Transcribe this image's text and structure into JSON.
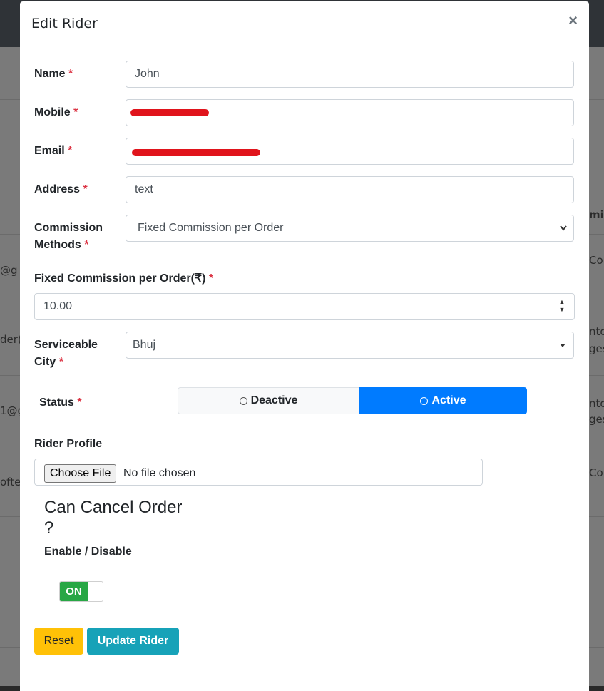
{
  "background": {
    "fragments_left": [
      "@g",
      "der(",
      "1@g",
      "ofte"
    ],
    "fragments_right": [
      "mis",
      "Co",
      "nto",
      "ges",
      "nto",
      "ges",
      "Co"
    ]
  },
  "modal": {
    "title": "Edit Rider",
    "close_symbol": "×"
  },
  "form": {
    "name": {
      "label": "Name",
      "value": "John"
    },
    "mobile": {
      "label": "Mobile",
      "value": ""
    },
    "email": {
      "label": "Email",
      "value": ""
    },
    "address": {
      "label": "Address",
      "value": "text"
    },
    "commission": {
      "label_line1": "Commission",
      "label_line2": "Methods",
      "value": "Fixed Commission per Order"
    },
    "fixed_commission": {
      "label": "Fixed Commission per Order(₹)",
      "value": "10.00"
    },
    "city": {
      "label_line1": "Serviceable",
      "label_line2": "City",
      "value": "Bhuj"
    },
    "status": {
      "label": "Status",
      "deactive_label": "Deactive",
      "active_label": "Active",
      "selected": "Active"
    },
    "profile": {
      "label": "Rider Profile",
      "button_label": "Choose File",
      "file_text": "No file chosen"
    },
    "cancel_order": {
      "heading_line1": "Can Cancel Order",
      "heading_line2": "?",
      "sublabel": "Enable / Disable",
      "switch_label": "ON"
    }
  },
  "required_mark": "*",
  "buttons": {
    "reset_label": "Reset",
    "update_label": "Update Rider"
  },
  "icons": {
    "select_arrow": "chevron-down-icon",
    "caret": "caret-down-icon",
    "spinner_up": "▲",
    "spinner_down": "▼"
  },
  "colors": {
    "primary": "#007bff",
    "info": "#17a2b8",
    "warning": "#ffc107",
    "success": "#28a745",
    "danger": "#dc3545"
  }
}
